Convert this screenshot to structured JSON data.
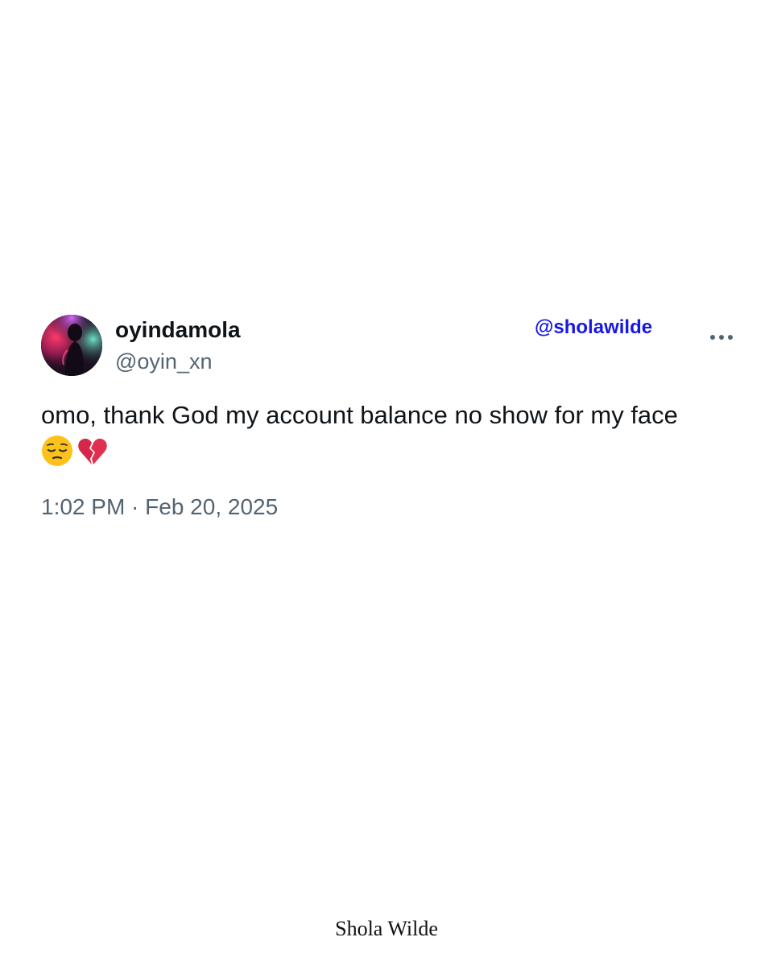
{
  "tweet": {
    "author": {
      "display_name": "oyindamola",
      "handle": "@oyin_xn",
      "avatar_icon": "profile-photo"
    },
    "watermark_handle": "@sholawilde",
    "more_icon": "more-horizontal-icon",
    "text": "omo, thank God my account balance no show for my face",
    "emojis": [
      "pensive-face-emoji",
      "broken-heart-emoji"
    ],
    "timestamp": "1:02 PM · Feb 20, 2025"
  },
  "footer": {
    "signature": "Shola Wilde"
  },
  "colors": {
    "text_primary": "#0f1419",
    "text_secondary": "#536471",
    "watermark_blue": "#1717e6",
    "background": "#ffffff"
  }
}
